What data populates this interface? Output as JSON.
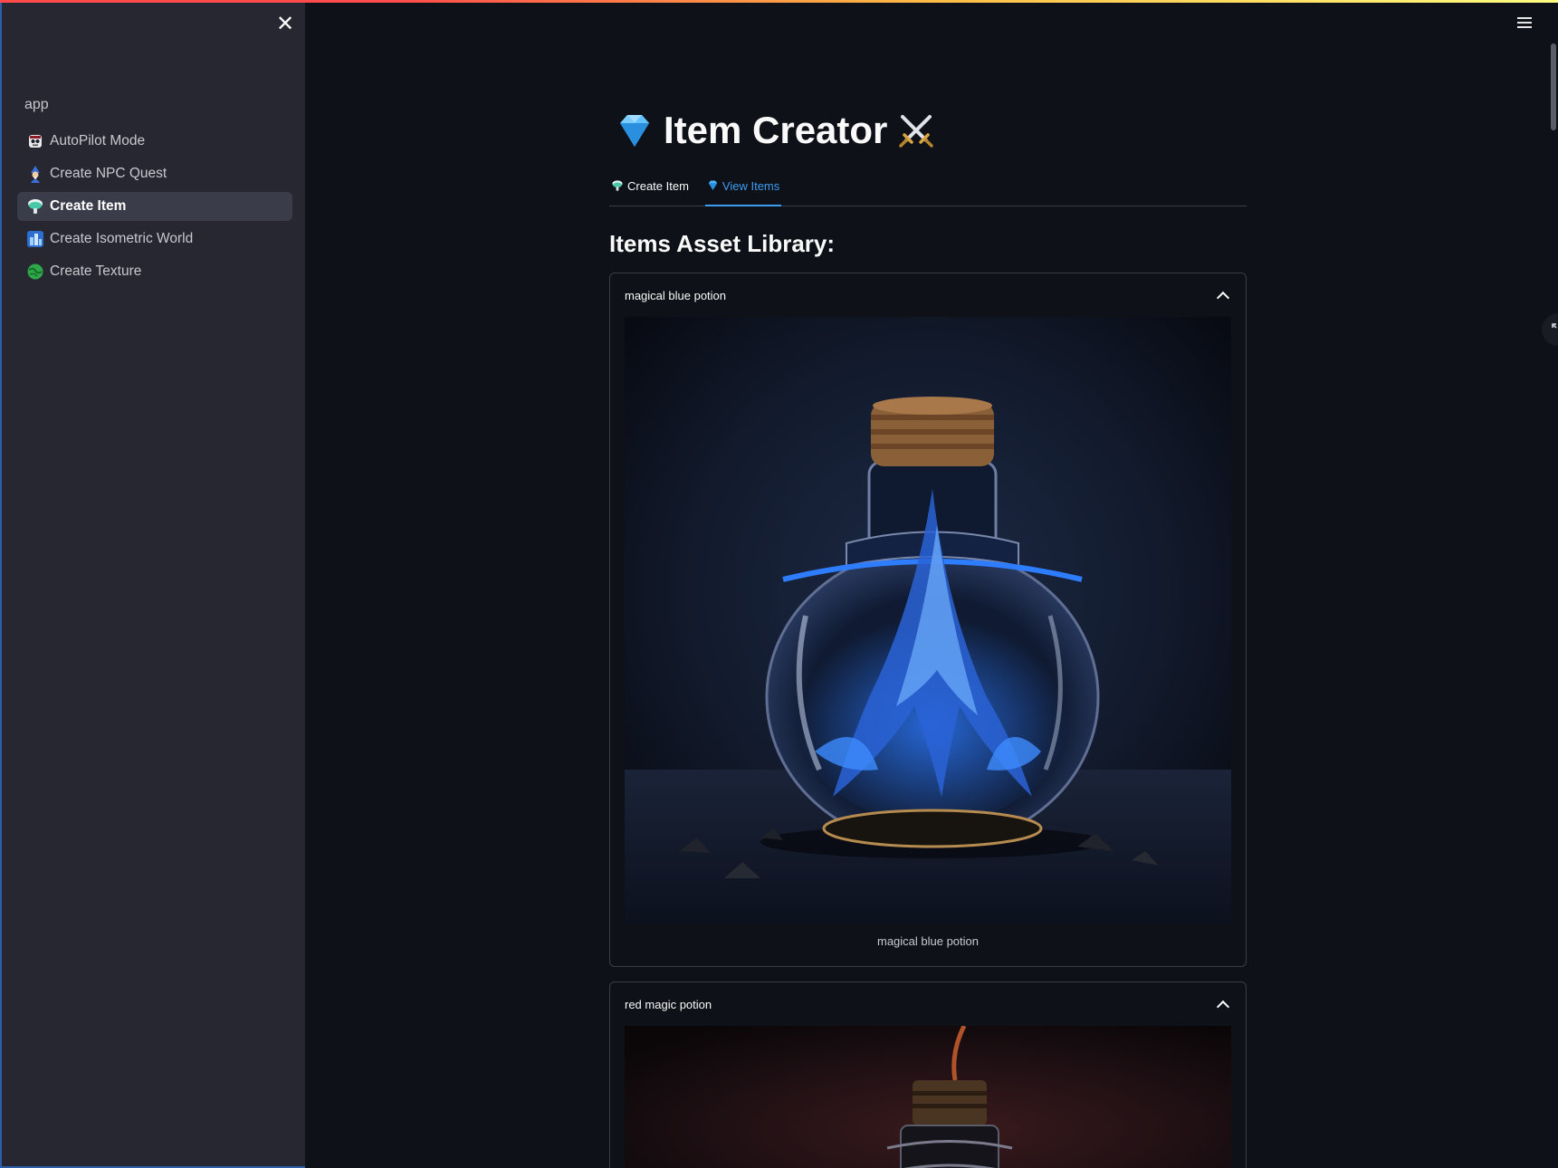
{
  "sidebar": {
    "close_label": "✕",
    "app_label": "app",
    "items": [
      {
        "label": "AutoPilot Mode",
        "icon": "robot-icon",
        "active": false
      },
      {
        "label": "Create NPC Quest",
        "icon": "wizard-icon",
        "active": false
      },
      {
        "label": "Create Item",
        "icon": "potion-icon",
        "active": true
      },
      {
        "label": "Create Isometric World",
        "icon": "cityscape-icon",
        "active": false
      },
      {
        "label": "Create Texture",
        "icon": "globe-icon",
        "active": false
      }
    ]
  },
  "header": {
    "title": "Item Creator",
    "title_left_icon": "gem-icon",
    "title_right_icon": "crossed-swords-icon"
  },
  "tabs": [
    {
      "label": "Create Item",
      "icon": "potion-icon",
      "active": false
    },
    {
      "label": "View Items",
      "icon": "gem-icon",
      "active": true
    }
  ],
  "library": {
    "heading": "Items Asset Library:",
    "items": [
      {
        "title": "magical blue potion",
        "caption": "magical blue potion",
        "expanded": true
      },
      {
        "title": "red magic potion",
        "caption": "",
        "expanded": true
      }
    ]
  },
  "colors": {
    "background": "#0e1117",
    "sidebar": "#262730",
    "accent": "#3d9df3",
    "active_nav": "#3a3c4a"
  }
}
